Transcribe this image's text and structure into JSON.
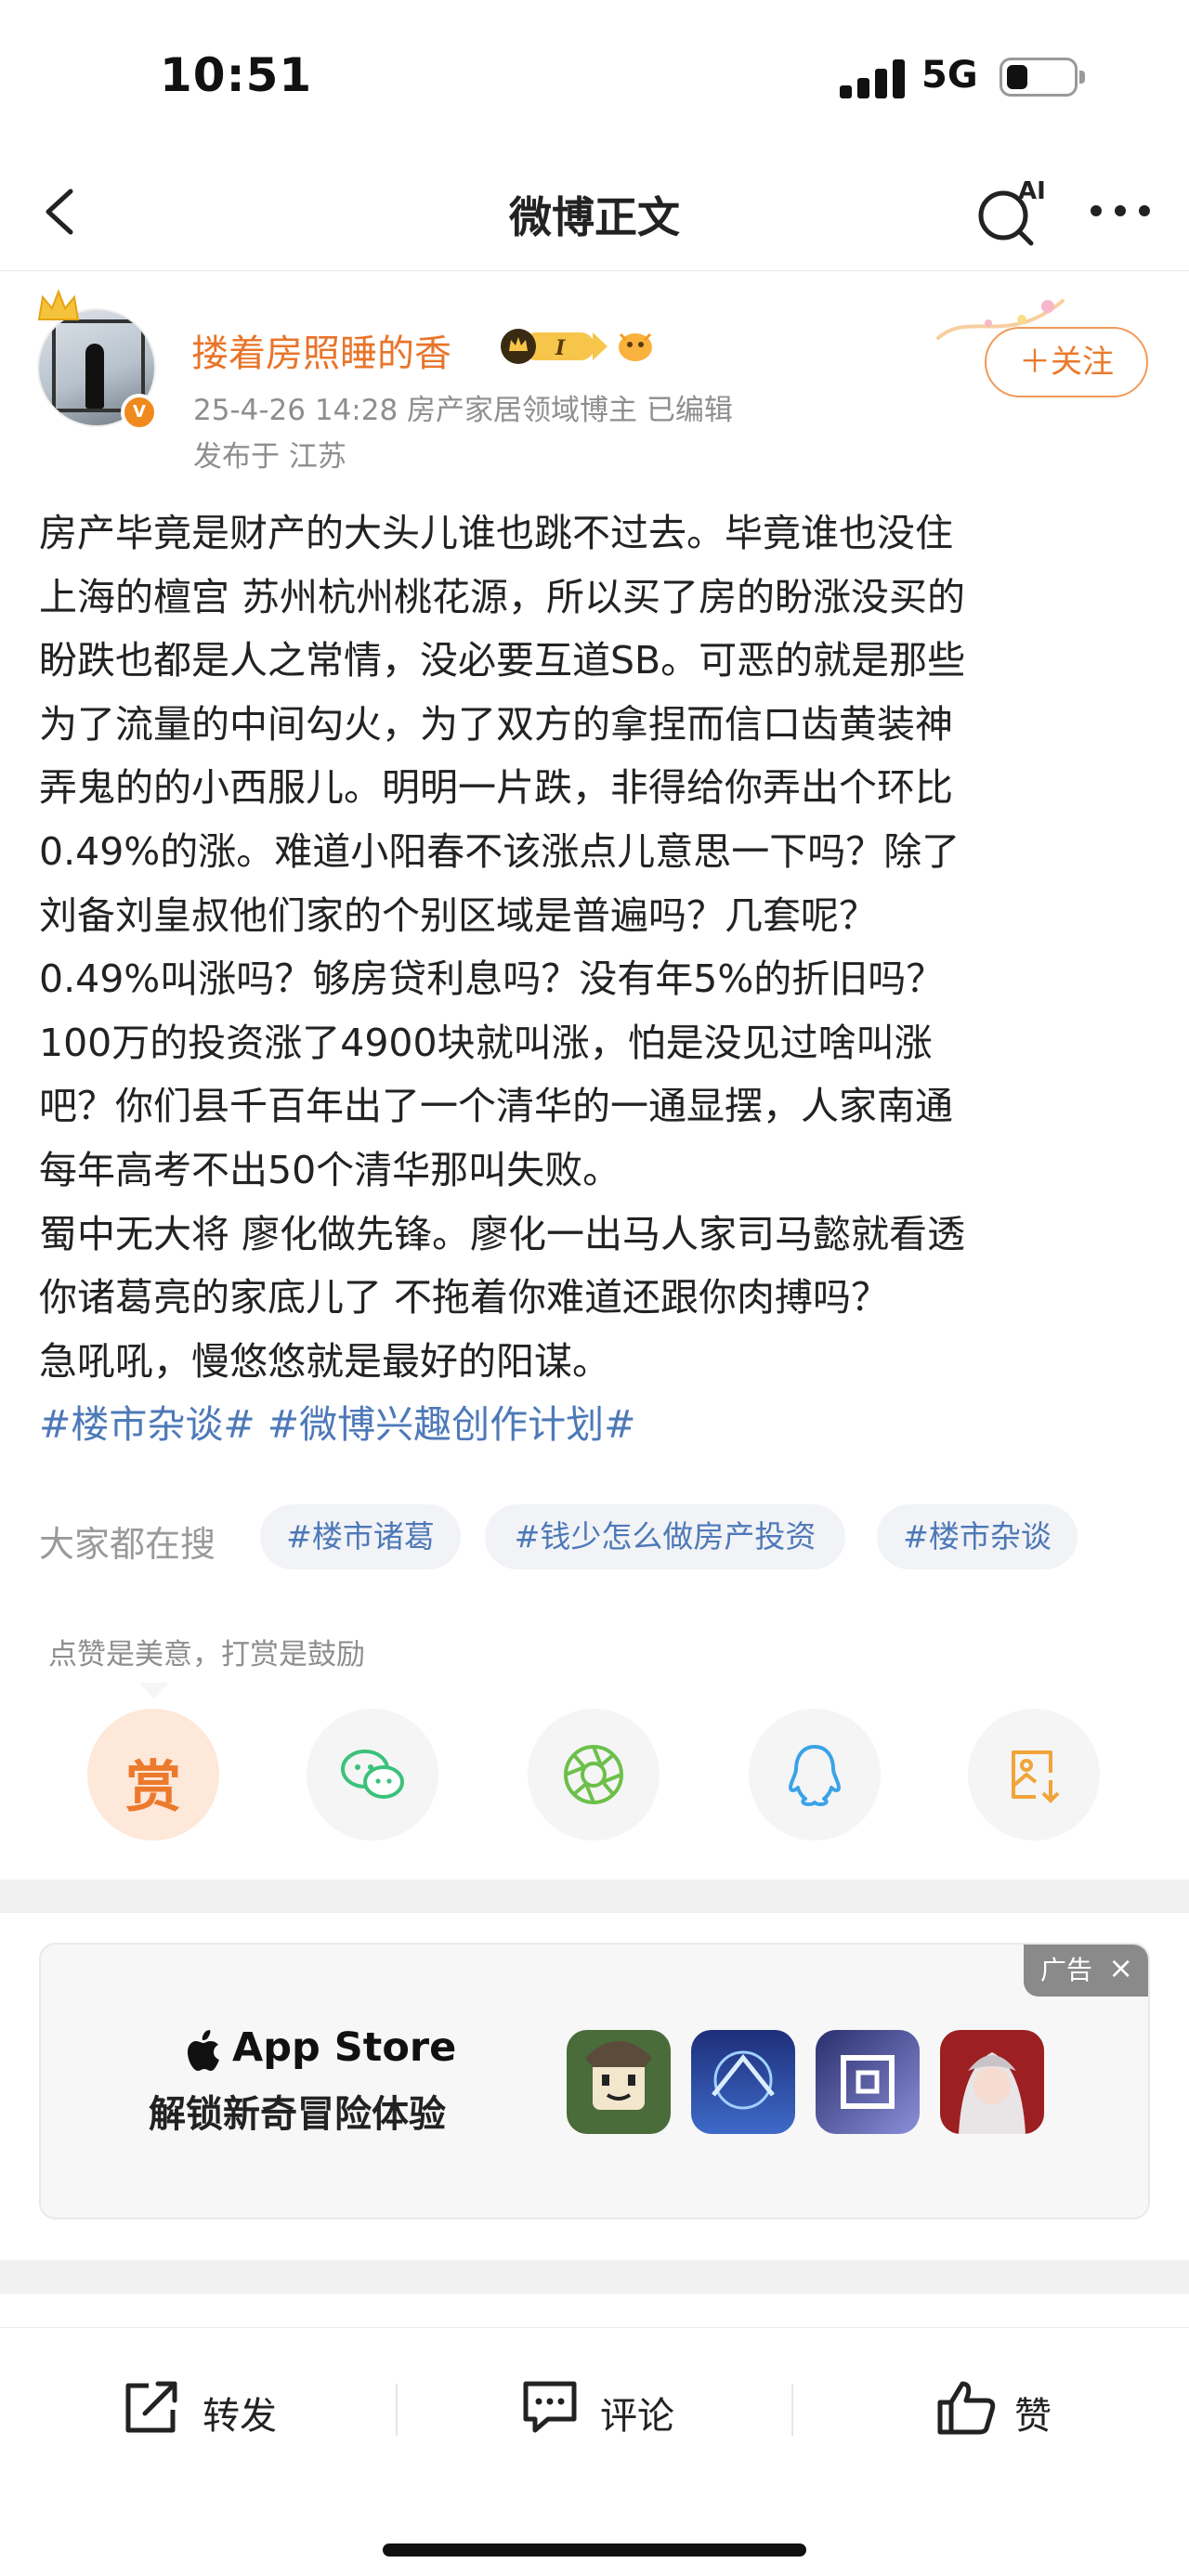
{
  "status_bar": {
    "time": "10:51",
    "network": "5G"
  },
  "nav": {
    "title": "微博正文",
    "ai_label": "AI"
  },
  "author": {
    "name": "搂着房照睡的香",
    "vip_level": "I",
    "meta": "25-4-26 14:28  房产家居领域博主  已编辑",
    "location": "发布于 江苏",
    "follow_label": "＋关注"
  },
  "post": {
    "lines": [
      "房产毕竟是财产的大头儿谁也跳不过去。毕竟谁也没住",
      "上海的檀宫 苏州杭州桃花源，所以买了房的盼涨没买的",
      "盼跌也都是人之常情，没必要互道SB。可恶的就是那些",
      "为了流量的中间勾火，为了双方的拿捏而信口齿黄装神",
      "弄鬼的的小西服儿。明明一片跌，非得给你弄出个环比",
      "0.49%的涨。难道小阳春不该涨点儿意思一下吗？除了",
      "刘备刘皇叔他们家的个别区域是普遍吗？几套呢？",
      "0.49%叫涨吗？够房贷利息吗？没有年5%的折旧吗？",
      "100万的投资涨了4900块就叫涨，怕是没见过啥叫涨",
      "吧？你们县千百年出了一个清华的一通显摆，人家南通",
      "每年高考不出50个清华那叫失败。",
      "蜀中无大将 廖化做先锋。廖化一出马人家司马懿就看透",
      "你诸葛亮的家底儿了 不拖着你难道还跟你肉搏吗？",
      "急吼吼，慢悠悠就是最好的阳谋。"
    ],
    "hashtags": "#楼市杂谈# #微博兴趣创作计划#"
  },
  "hot_search": {
    "label": "大家都在搜",
    "tags": [
      "#楼市诸葛",
      "#钱少怎么做房产投资",
      "#楼市杂谈"
    ]
  },
  "reward": {
    "hint": "点赞是美意，打赏是鼓励",
    "button_label": "赏"
  },
  "share_icons": [
    "wechat-icon",
    "moments-icon",
    "qq-icon",
    "save-image-icon"
  ],
  "ad": {
    "badge": "广告",
    "close": "×",
    "brand": "App Store",
    "slogan": "解锁新奇冒险体验"
  },
  "toolbar": {
    "repost": "转发",
    "comment": "评论",
    "like": "赞"
  },
  "colors": {
    "accent_orange": "#ec7a2c",
    "link_blue": "#4d79b8",
    "wechat_green": "#3cc17a",
    "qq_blue": "#3aa3e8",
    "save_orange": "#f0a43a"
  }
}
